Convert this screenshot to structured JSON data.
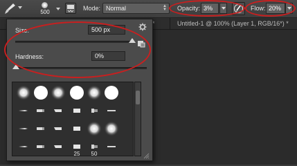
{
  "options_bar": {
    "brush_size": "500",
    "mode_label": "Mode:",
    "mode_value": "Normal",
    "opacity_label": "Opacity:",
    "opacity_value": "3%",
    "flow_label": "Flow:",
    "flow_value": "20%"
  },
  "document_tabs": [
    {
      "label": "*"
    },
    {
      "label": "Untitled-1 @ 100% (Layer 1, RGB/16*) *"
    }
  ],
  "brush_panel": {
    "size_label": "Size:",
    "size_value": "500 px",
    "size_level": 0.96,
    "hardness_label": "Hardness:",
    "hardness_value": "0%",
    "hardness_level": 0.0,
    "presets": [
      {
        "kind": "soft",
        "label": ""
      },
      {
        "kind": "hard",
        "label": ""
      },
      {
        "kind": "soft",
        "label": ""
      },
      {
        "kind": "hard",
        "label": ""
      },
      {
        "kind": "soft",
        "label": ""
      },
      {
        "kind": "hard",
        "label": ""
      },
      {
        "kind": "tip",
        "label": ""
      },
      {
        "kind": "tip",
        "label": ""
      },
      {
        "kind": "tip",
        "label": ""
      },
      {
        "kind": "tip",
        "label": ""
      },
      {
        "kind": "tip",
        "label": ""
      },
      {
        "kind": "tip",
        "label": ""
      },
      {
        "kind": "tip",
        "label": ""
      },
      {
        "kind": "tip",
        "label": ""
      },
      {
        "kind": "tip",
        "label": ""
      },
      {
        "kind": "tip",
        "label": ""
      },
      {
        "kind": "soft",
        "label": ""
      },
      {
        "kind": "soft",
        "label": ""
      },
      {
        "kind": "tip",
        "label": ""
      },
      {
        "kind": "tip",
        "label": ""
      },
      {
        "kind": "tip",
        "label": ""
      },
      {
        "kind": "tip",
        "label": "25"
      },
      {
        "kind": "tip",
        "label": "50"
      },
      {
        "kind": "tip",
        "label": ""
      }
    ]
  },
  "colors": {
    "annotation_red": "#c91f1f",
    "panel_bg": "#4b4b4b",
    "workspace_bg": "#2b2b2b"
  },
  "icons": {
    "tool": "brush-icon",
    "panel_toggle": "brush-panel-icon",
    "pressure": "tablet-pressure-icon",
    "settings": "gear-icon",
    "new_preset": "new-preset-icon"
  }
}
